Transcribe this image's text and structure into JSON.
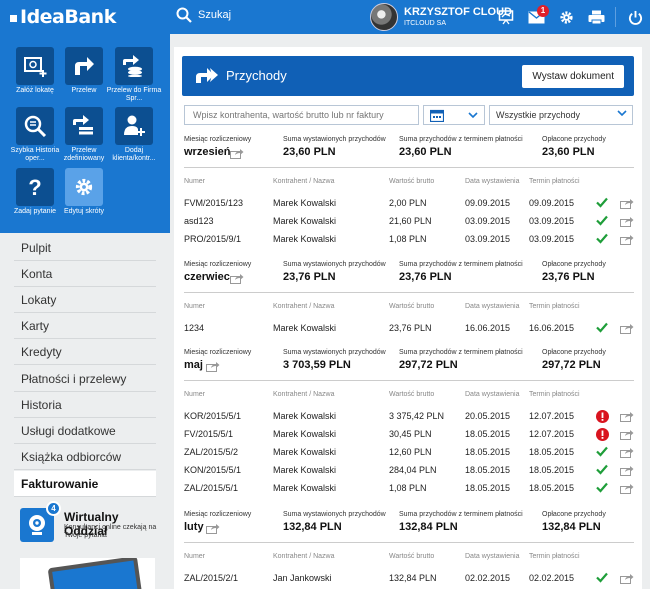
{
  "header": {
    "brand": "IdeaBank",
    "search_label": "Szukaj",
    "user_name": "KRZYSZTOF CLOUD",
    "user_company": "ITCLOUD SA",
    "message_count": "1"
  },
  "tiles": [
    {
      "label": "Załóż lokatę",
      "icon": "deposit-icon"
    },
    {
      "label": "Przelew",
      "icon": "transfer-icon"
    },
    {
      "label": "Przelew do Firma Spr...",
      "icon": "transfer-coins-icon"
    },
    {
      "label": "Szybka Historia oper...",
      "icon": "history-search-icon"
    },
    {
      "label": "Przelew zdefiniowany",
      "icon": "defined-transfer-icon"
    },
    {
      "label": "Dodaj klienta/kontr...",
      "icon": "add-client-icon"
    },
    {
      "label": "Zadaj pytanie",
      "icon": "question-icon"
    },
    {
      "label": "Edytuj skróty",
      "icon": "gear-icon"
    }
  ],
  "nav": [
    "Pulpit",
    "Konta",
    "Lokaty",
    "Karty",
    "Kredyty",
    "Płatności i przelewy",
    "Historia",
    "Usługi dodatkowe",
    "Książka odbiorców",
    "Fakturowanie"
  ],
  "nav_active": "Fakturowanie",
  "virtual_office": {
    "badge": "4",
    "title": "Wirtualny Oddział",
    "subtitle": "Konsultanci online czekają na Twoje pytania"
  },
  "panel": {
    "title": "Przychody",
    "issue_button": "Wystaw dokument",
    "search_placeholder": "Wpisz kontrahenta, wartość brutto lub nr faktury",
    "filter_selected": "Wszystkie przychody"
  },
  "labels": {
    "month": "Miesiąc rozliczeniowy",
    "sum_issued": "Suma wystawionych przychodów",
    "sum_due": "Suma przychodów z terminem płatności",
    "paid": "Opłacone przychody",
    "col_number": "Numer",
    "col_contractor": "Kontrahent / Nazwa",
    "col_gross": "Wartość brutto",
    "col_issue_date": "Data wystawienia",
    "col_due_date": "Termin płatności"
  },
  "sections": [
    {
      "month": "wrzesień",
      "sum_issued": "23,60 PLN",
      "sum_due": "23,60 PLN",
      "paid": "23,60 PLN",
      "rows": [
        {
          "number": "FVM/2015/123",
          "contractor": "Marek Kowalski",
          "gross": "2,00 PLN",
          "issued": "09.09.2015",
          "due": "09.09.2015",
          "status": "paid"
        },
        {
          "number": "asd123",
          "contractor": "Marek Kowalski",
          "gross": "21,60 PLN",
          "issued": "03.09.2015",
          "due": "03.09.2015",
          "status": "paid"
        },
        {
          "number": "PRO/2015/9/1",
          "contractor": "Marek Kowalski",
          "gross": "1,08 PLN",
          "issued": "03.09.2015",
          "due": "03.09.2015",
          "status": "paid"
        }
      ]
    },
    {
      "month": "czerwiec",
      "sum_issued": "23,76 PLN",
      "sum_due": "23,76 PLN",
      "paid": "23,76 PLN",
      "rows": [
        {
          "number": "1234",
          "contractor": "Marek Kowalski",
          "gross": "23,76 PLN",
          "issued": "16.06.2015",
          "due": "16.06.2015",
          "status": "paid"
        }
      ]
    },
    {
      "month": "maj",
      "sum_issued": "3 703,59 PLN",
      "sum_due": "297,72 PLN",
      "paid": "297,72 PLN",
      "rows": [
        {
          "number": "KOR/2015/5/1",
          "contractor": "Marek Kowalski",
          "gross": "3 375,42 PLN",
          "issued": "20.05.2015",
          "due": "12.07.2015",
          "status": "overdue"
        },
        {
          "number": "FV/2015/5/1",
          "contractor": "Marek Kowalski",
          "gross": "30,45 PLN",
          "issued": "18.05.2015",
          "due": "12.07.2015",
          "status": "overdue"
        },
        {
          "number": "ZAL/2015/5/2",
          "contractor": "Marek Kowalski",
          "gross": "12,60 PLN",
          "issued": "18.05.2015",
          "due": "18.05.2015",
          "status": "paid"
        },
        {
          "number": "KON/2015/5/1",
          "contractor": "Marek Kowalski",
          "gross": "284,04 PLN",
          "issued": "18.05.2015",
          "due": "18.05.2015",
          "status": "paid"
        },
        {
          "number": "ZAL/2015/5/1",
          "contractor": "Marek Kowalski",
          "gross": "1,08 PLN",
          "issued": "18.05.2015",
          "due": "18.05.2015",
          "status": "paid"
        }
      ]
    },
    {
      "month": "luty",
      "sum_issued": "132,84 PLN",
      "sum_due": "132,84 PLN",
      "paid": "132,84 PLN",
      "rows": [
        {
          "number": "ZAL/2015/2/1",
          "contractor": "Jan Jankowski",
          "gross": "132,84 PLN",
          "issued": "02.02.2015",
          "due": "02.02.2015",
          "status": "paid"
        }
      ]
    }
  ],
  "colors": {
    "brand_blue": "#1a77d0",
    "dark_blue": "#1060b6",
    "paid_green": "#1f9e3a",
    "overdue_red": "#d9141f"
  }
}
